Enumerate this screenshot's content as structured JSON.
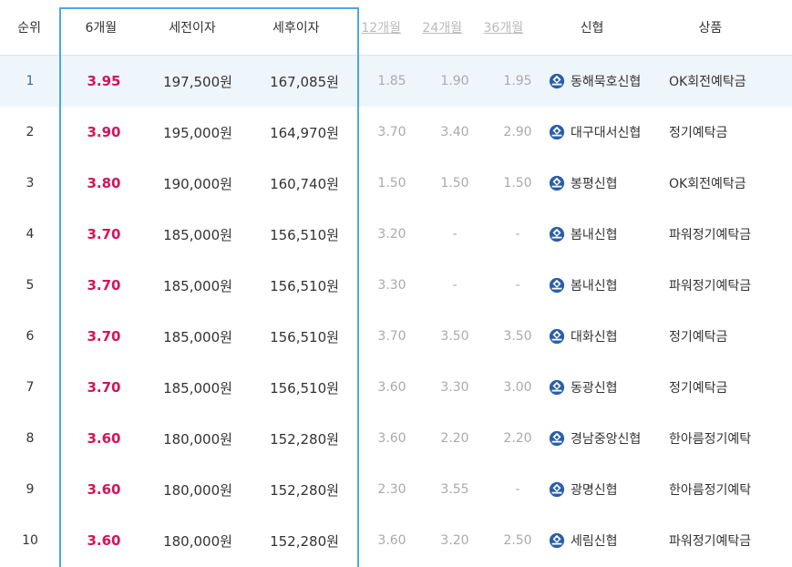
{
  "headers": {
    "rank": "순위",
    "m6": "6개월",
    "pre_tax": "세전이자",
    "post_tax": "세후이자",
    "m12": "12개월",
    "m24": "24개월",
    "m36": "36개월",
    "bank": "신협",
    "product": "상품"
  },
  "rows": [
    {
      "rank": "1",
      "m6": "3.95",
      "pre_tax": "197,500원",
      "post_tax": "167,085원",
      "m12": "1.85",
      "m24": "1.90",
      "m36": "1.95",
      "bank": "동해묵호신협",
      "product": "OK회전예탁금"
    },
    {
      "rank": "2",
      "m6": "3.90",
      "pre_tax": "195,000원",
      "post_tax": "164,970원",
      "m12": "3.70",
      "m24": "3.40",
      "m36": "2.90",
      "bank": "대구대서신협",
      "product": "정기예탁금"
    },
    {
      "rank": "3",
      "m6": "3.80",
      "pre_tax": "190,000원",
      "post_tax": "160,740원",
      "m12": "1.50",
      "m24": "1.50",
      "m36": "1.50",
      "bank": "봉평신협",
      "product": "OK회전예탁금"
    },
    {
      "rank": "4",
      "m6": "3.70",
      "pre_tax": "185,000원",
      "post_tax": "156,510원",
      "m12": "3.20",
      "m24": "-",
      "m36": "-",
      "bank": "봄내신협",
      "product": "파워정기예탁금"
    },
    {
      "rank": "5",
      "m6": "3.70",
      "pre_tax": "185,000원",
      "post_tax": "156,510원",
      "m12": "3.30",
      "m24": "-",
      "m36": "-",
      "bank": "봄내신협",
      "product": "파워정기예탁금"
    },
    {
      "rank": "6",
      "m6": "3.70",
      "pre_tax": "185,000원",
      "post_tax": "156,510원",
      "m12": "3.70",
      "m24": "3.50",
      "m36": "3.50",
      "bank": "대화신협",
      "product": "정기예탁금"
    },
    {
      "rank": "7",
      "m6": "3.70",
      "pre_tax": "185,000원",
      "post_tax": "156,510원",
      "m12": "3.60",
      "m24": "3.30",
      "m36": "3.00",
      "bank": "동광신협",
      "product": "정기예탁금"
    },
    {
      "rank": "8",
      "m6": "3.60",
      "pre_tax": "180,000원",
      "post_tax": "152,280원",
      "m12": "3.60",
      "m24": "2.20",
      "m36": "2.20",
      "bank": "경남중앙신협",
      "product": "한아름정기예탁"
    },
    {
      "rank": "9",
      "m6": "3.60",
      "pre_tax": "180,000원",
      "post_tax": "152,280원",
      "m12": "2.30",
      "m24": "3.55",
      "m36": "-",
      "bank": "광명신협",
      "product": "한아름정기예탁"
    },
    {
      "rank": "10",
      "m6": "3.60",
      "pre_tax": "180,000원",
      "post_tax": "152,280원",
      "m12": "3.60",
      "m24": "3.20",
      "m36": "2.50",
      "bank": "세림신협",
      "product": "파워정기예탁금"
    }
  ],
  "colors": {
    "accent_rate": "#d4145a",
    "highlight_border": "#4ea6e8",
    "selected_row_bg": "#eef6fc",
    "muted_text": "#aaaaaa",
    "logo_blue": "#2a5fa8"
  },
  "icons": {
    "bank_logo": "credit-union-logo-icon"
  }
}
